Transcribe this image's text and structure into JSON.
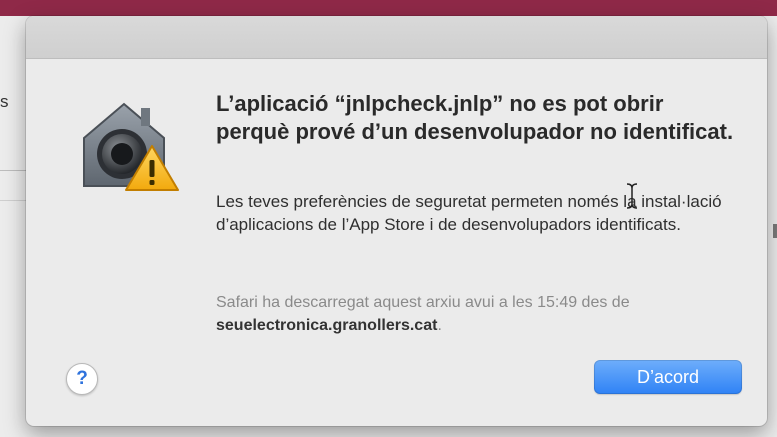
{
  "background": {
    "fragment_text": "s",
    "topbar_color": "#8f2948"
  },
  "dialog": {
    "icon": "gatekeeper-warning-icon",
    "title": "L’aplicació “jnlpcheck.jnlp” no es pot obrir perquè prové d’un desenvolupador no identificat.",
    "message": "Les teves preferències de seguretat permeten només la instal·lació d’aplicacions de l’App Store i de desenvolupadors identificats.",
    "info_prefix": "Safari ha descarregat aquest arxiu avui a les 15:49 des de ",
    "info_domain": "seuelectronica.granollers.cat",
    "info_suffix": ".",
    "help_label": "?",
    "ok_label": "D’acord"
  },
  "colors": {
    "accent": "#2f82f5",
    "warning": "#f5c433"
  }
}
